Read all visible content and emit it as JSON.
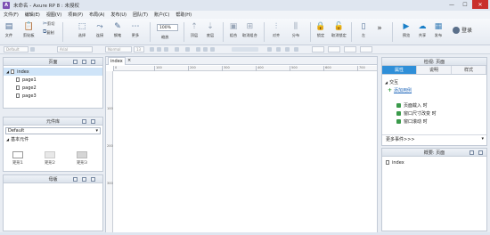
{
  "window": {
    "title": "未命名 - Axure RP 8 : 未授权",
    "app_icon": "A",
    "min": "—",
    "max": "☐",
    "close": "✕"
  },
  "menu": [
    "文件(F)",
    "编辑(E)",
    "视图(V)",
    "项目(P)",
    "布局(A)",
    "发布(U)",
    "团队(T)",
    "账户(C)",
    "帮助(H)"
  ],
  "toolbar": {
    "file": "文件",
    "clipboard": "剪贴板",
    "cut": "剪切",
    "copy": "复制",
    "select": "选择",
    "connect": "连接",
    "pen": "钢笔",
    "more": "更多",
    "zoom": "100%",
    "zoom_label": "缩放",
    "top": "顶层",
    "bottom": "底层",
    "group": "组合",
    "ungroup": "取消组合",
    "align": "对齐",
    "distribute": "分布",
    "lock": "锁定",
    "unlock": "取消锁定",
    "left": "左",
    "preview": "预览",
    "share": "共享",
    "publish": "发布",
    "login": "登录",
    "expand": "»"
  },
  "format": {
    "style": "Default",
    "font": "Arial",
    "weight": "Normal",
    "size": "13"
  },
  "pages_panel": {
    "title": "页面",
    "items": [
      {
        "label": "index"
      },
      {
        "label": "page1"
      },
      {
        "label": "page2"
      },
      {
        "label": "page3"
      }
    ]
  },
  "library_panel": {
    "title": "元件库",
    "selected": "Default",
    "group": "基本元件",
    "widgets": [
      {
        "label": "矩形1"
      },
      {
        "label": "矩形2"
      },
      {
        "label": "矩形3"
      }
    ]
  },
  "masters_panel": {
    "title": "母版"
  },
  "canvas": {
    "tab": "index",
    "h_ticks": [
      "0",
      "100",
      "200",
      "300",
      "400",
      "500",
      "600",
      "700"
    ],
    "v_ticks": [
      "100",
      "200",
      "300"
    ]
  },
  "inspector": {
    "header": "检视: 页面",
    "tabs": [
      "属性",
      "说明",
      "样式"
    ],
    "section": "交互",
    "add_case": "添加用例",
    "events": [
      "页面载入 时",
      "窗口尺寸改变 时",
      "窗口滚动 时"
    ],
    "more_events": "更多事件>>>"
  },
  "outline": {
    "title": "概要: 页面",
    "item": "index"
  },
  "colors": {
    "accent": "#2f8fd8",
    "close": "#c9302c",
    "brand": "#7b4fb3"
  }
}
